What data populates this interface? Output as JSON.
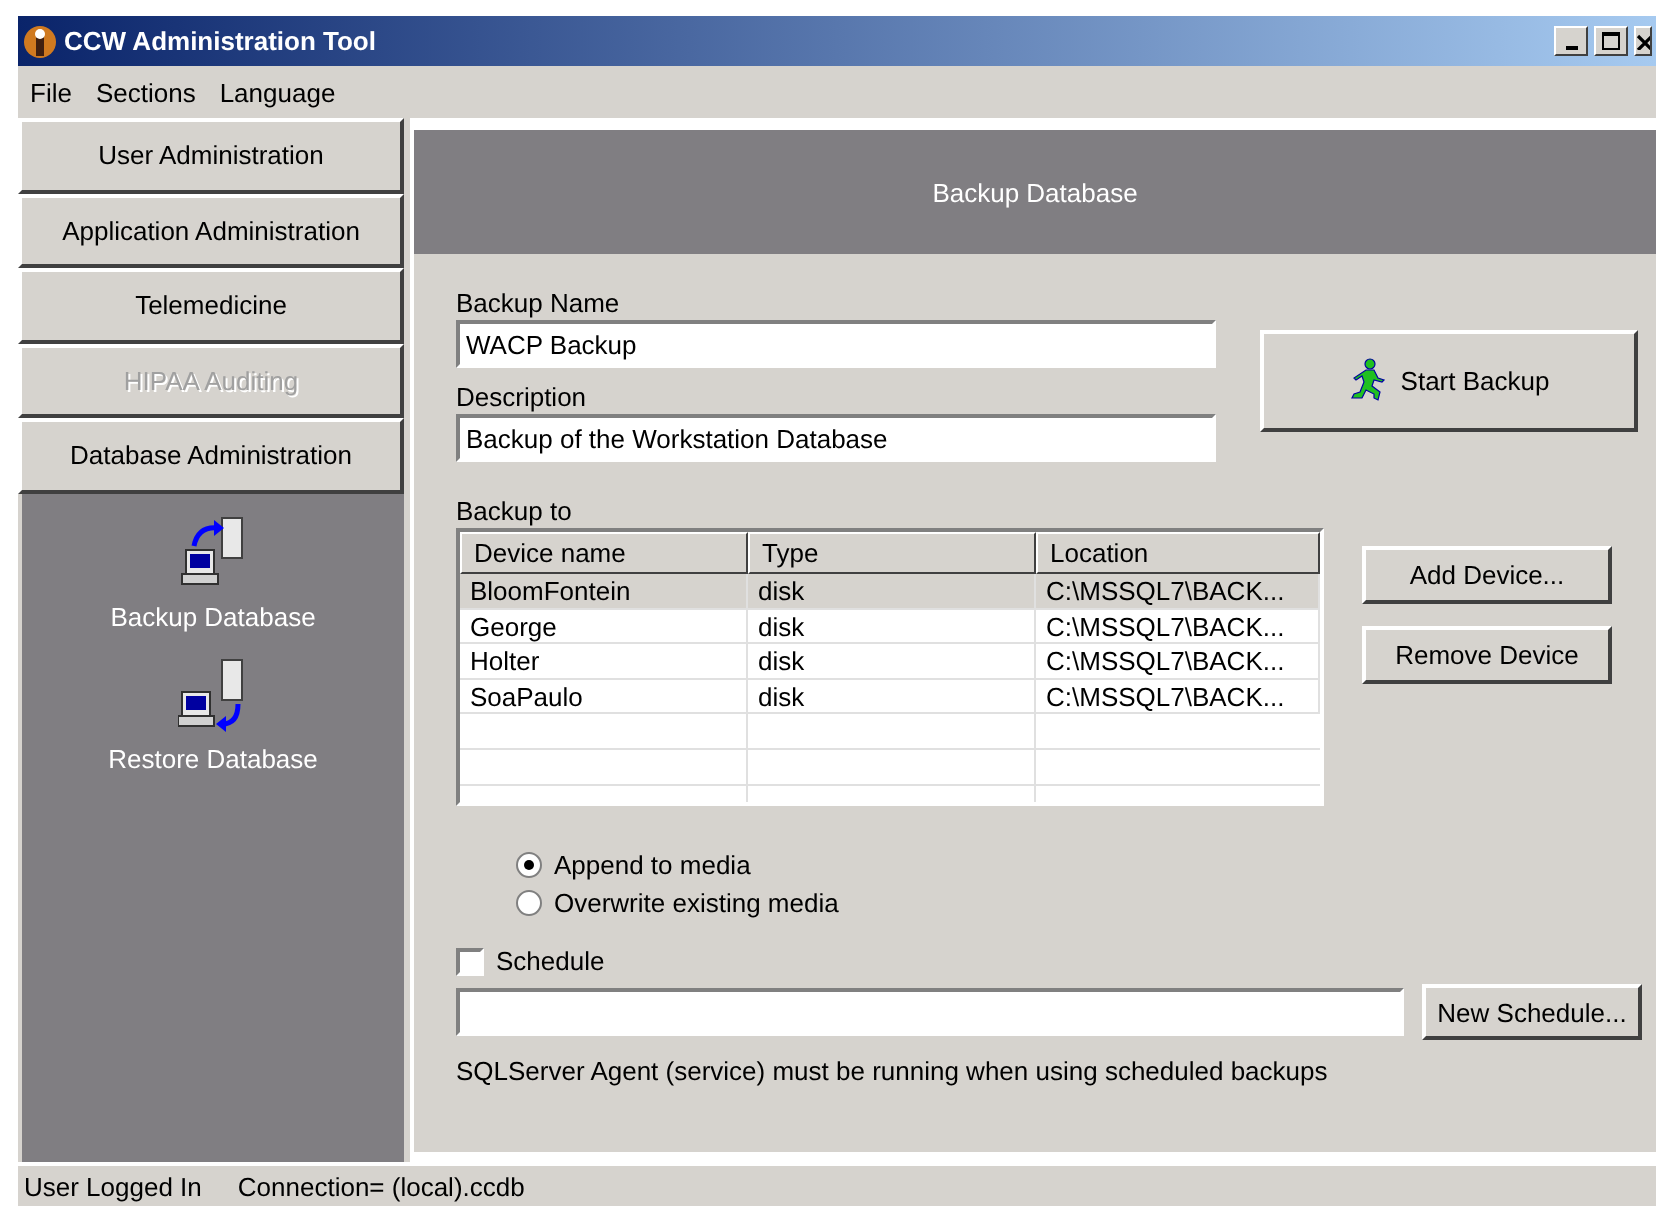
{
  "window": {
    "title": "CCW Administration Tool"
  },
  "menu": [
    {
      "label": "File"
    },
    {
      "label": "Sections"
    },
    {
      "label": "Language"
    }
  ],
  "sidebar": {
    "sections": [
      {
        "label": "User Administration",
        "disabled": false
      },
      {
        "label": "Application Administration",
        "disabled": false
      },
      {
        "label": "Telemedicine",
        "disabled": false
      },
      {
        "label": "HIPAA Auditing",
        "disabled": true
      },
      {
        "label": "Database Administration",
        "disabled": false,
        "items": [
          {
            "label": "Backup Database",
            "kind": "backup"
          },
          {
            "label": "Restore Database",
            "kind": "restore"
          }
        ]
      }
    ]
  },
  "panel": {
    "title": "Backup Database",
    "backup_name": {
      "label": "Backup Name",
      "value": "WACP Backup"
    },
    "description": {
      "label": "Description",
      "value": "Backup of the Workstation Database"
    },
    "start_button": "Start Backup",
    "backup_to": {
      "label": "Backup to",
      "columns": [
        "Device name",
        "Type",
        "Location"
      ],
      "rows": [
        {
          "cells": [
            "BloomFontein",
            "disk",
            "C:\\MSSQL7\\BACK..."
          ],
          "selected": true
        },
        {
          "cells": [
            "George",
            "disk",
            "C:\\MSSQL7\\BACK..."
          ],
          "selected": false
        },
        {
          "cells": [
            "Holter",
            "disk",
            "C:\\MSSQL7\\BACK..."
          ],
          "selected": false
        },
        {
          "cells": [
            "SoaPaulo",
            "disk",
            "C:\\MSSQL7\\BACK..."
          ],
          "selected": false
        }
      ]
    },
    "device_buttons": [
      "Add Device...",
      "Remove Device"
    ],
    "media_options": [
      {
        "label": "Append to media",
        "selected": true
      },
      {
        "label": "Overwrite existing media",
        "selected": false
      }
    ],
    "schedule": {
      "label": "Schedule",
      "checked": false,
      "button": "New Schedule..."
    },
    "note": "SQLServer Agent (service) must be running when using scheduled backups"
  },
  "status_bar": [
    "User Logged In",
    "Connection= (local).ccdb"
  ]
}
